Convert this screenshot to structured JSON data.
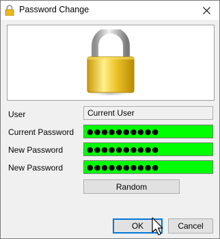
{
  "window": {
    "title": "Password Change"
  },
  "fields": {
    "user_label": "User",
    "user_value": "Current User",
    "current_password_label": "Current Password",
    "current_password_value": "●●●●●●●●●●",
    "new_password_label": "New Password",
    "new_password_value": "●●●●●●●●●●",
    "confirm_password_label": "New Password",
    "confirm_password_value": "●●●●●●●●●●"
  },
  "buttons": {
    "random": "Random",
    "ok": "OK",
    "cancel": "Cancel"
  },
  "colors": {
    "password_field_bg": "#00ff00",
    "focus_border": "#0078d7",
    "lock_gold": "#e0b820"
  },
  "icons": {
    "title": "lock-icon",
    "close": "close-icon",
    "banner": "padlock-icon",
    "cursor": "mouse-pointer-icon"
  }
}
